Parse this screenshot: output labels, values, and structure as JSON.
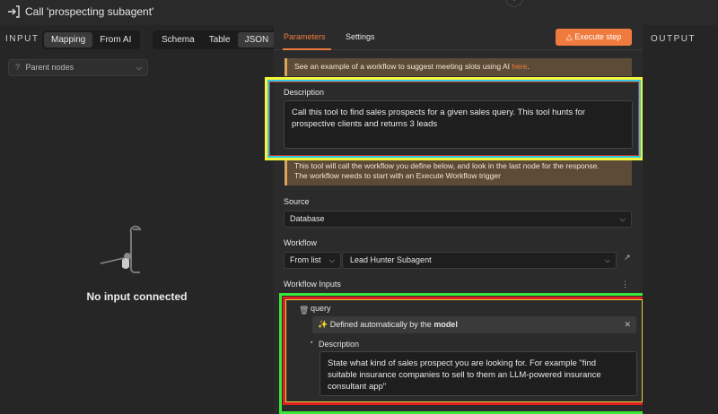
{
  "window": {
    "title": "Call 'prospecting subagent'",
    "plus_symbol": "+"
  },
  "left_panel": {
    "label": "INPUT",
    "mode_tabs": [
      "Mapping",
      "From AI"
    ],
    "view_tabs": [
      "Schema",
      "Table",
      "JSON"
    ],
    "parent_nodes": {
      "help_icon": "?",
      "label": "Parent nodes"
    },
    "empty_state": "No input connected"
  },
  "main": {
    "tabs": [
      "Parameters",
      "Settings"
    ],
    "execute_button": "Execute step",
    "tip": {
      "text": "See an example of a workflow to suggest meeting slots using AI ",
      "link": "here",
      "end": "."
    },
    "description": {
      "label": "Description",
      "value": "Call this tool to find sales prospects for a given sales query. This tool hunts for prospective clients and returns 3 leads"
    },
    "info_note": {
      "line1": "This tool will call the workflow you define below, and look in the last node for the response.",
      "line2": "The workflow needs to start with an Execute Workflow trigger"
    },
    "source": {
      "label": "Source",
      "value": "Database"
    },
    "workflow": {
      "label": "Workflow",
      "mode": "From list",
      "value": "Lead Hunter Subagent"
    },
    "workflow_inputs": {
      "label": "Workflow Inputs",
      "field_name": "query",
      "auto_prefix": "Defined automatically by the ",
      "auto_bold": "model",
      "desc_label": "Description",
      "desc_value": "State what kind of sales prospect you are looking for. For example \"find suitable insurance companies to sell to them an LLM-powered insurance consultant app\""
    }
  },
  "output_panel": {
    "label": "OUTPUT"
  },
  "colors": {
    "accent": "#f07b3f",
    "note_bg": "#5c4b36"
  }
}
